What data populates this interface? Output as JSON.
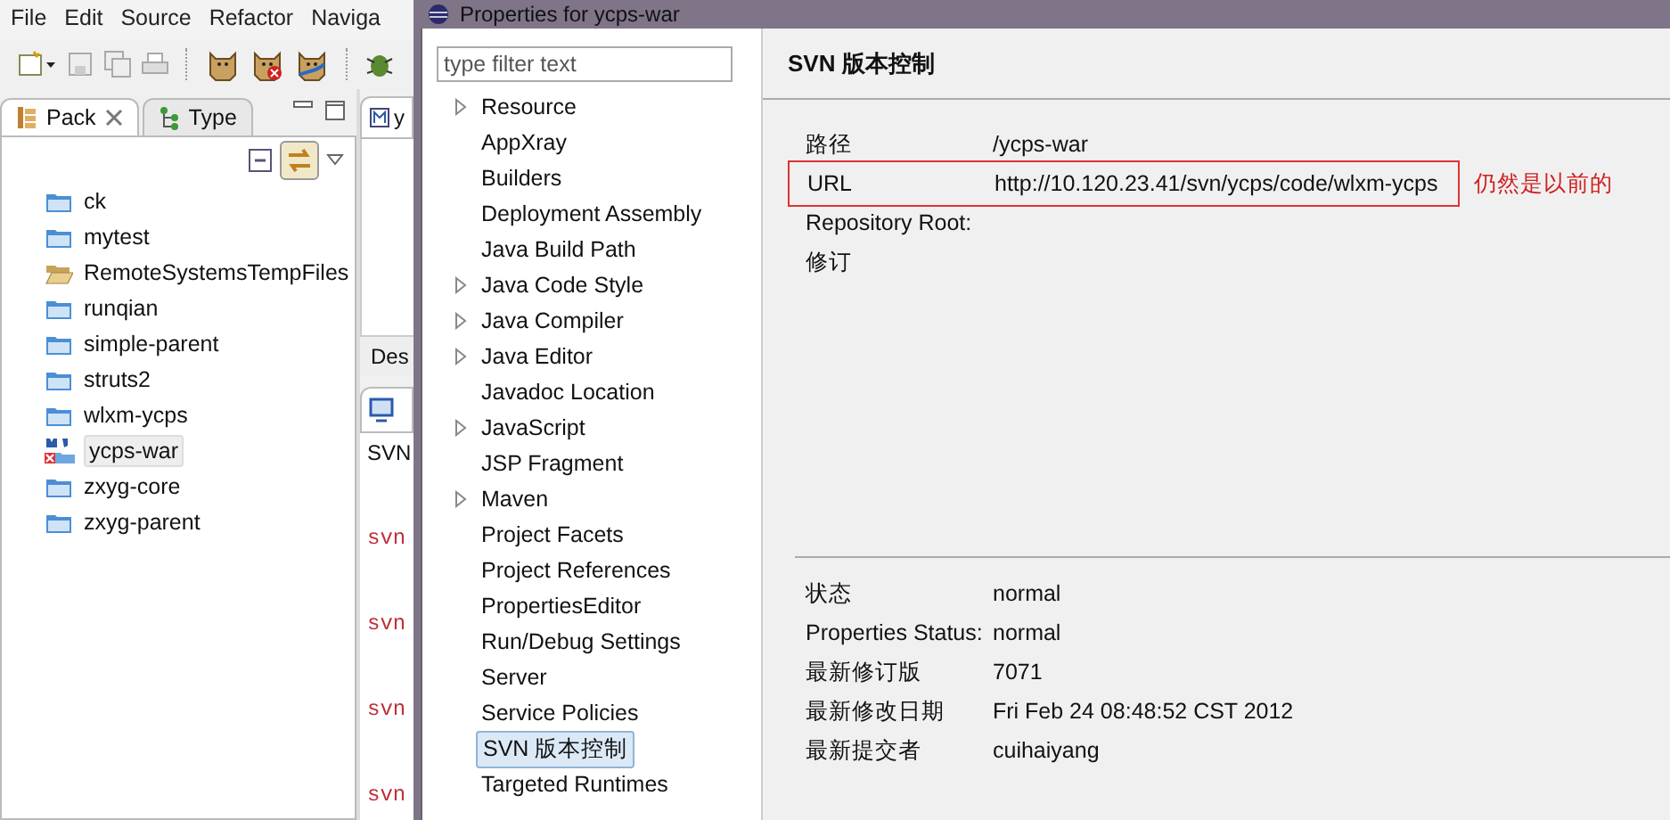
{
  "ide": {
    "menu": [
      "File",
      "Edit",
      "Source",
      "Refactor",
      "Naviga"
    ],
    "view_tabs": [
      {
        "label": "Pack",
        "selected": true
      },
      {
        "label": "Type",
        "selected": false
      }
    ],
    "link_with_editor": {
      "on": true
    },
    "projects": [
      {
        "name": "ck",
        "kind": "folder",
        "selected": false
      },
      {
        "name": "mytest",
        "kind": "folder",
        "selected": false
      },
      {
        "name": "RemoteSystemsTempFiles",
        "kind": "open-folder",
        "selected": false
      },
      {
        "name": "runqian",
        "kind": "folder",
        "selected": false
      },
      {
        "name": "simple-parent",
        "kind": "folder",
        "selected": false
      },
      {
        "name": "struts2",
        "kind": "folder",
        "selected": false
      },
      {
        "name": "wlxm-ycps",
        "kind": "folder",
        "selected": false
      },
      {
        "name": "ycps-war",
        "kind": "web-project",
        "selected": true
      },
      {
        "name": "zxyg-core",
        "kind": "folder",
        "selected": false
      },
      {
        "name": "zxyg-parent",
        "kind": "folder",
        "selected": false
      }
    ],
    "editor_tab": "y",
    "outline_tab": "Des",
    "console_header": "SVN",
    "console_lines": [
      "svn",
      "svn",
      "svn",
      "svn"
    ]
  },
  "dialog": {
    "title": "Properties for ycps-war",
    "filter": {
      "placeholder": "type filter text"
    },
    "pages": [
      {
        "label": "Resource",
        "expandable": true,
        "selected": false
      },
      {
        "label": "AppXray",
        "expandable": false,
        "selected": false
      },
      {
        "label": "Builders",
        "expandable": false,
        "selected": false
      },
      {
        "label": "Deployment Assembly",
        "expandable": false,
        "selected": false
      },
      {
        "label": "Java Build Path",
        "expandable": false,
        "selected": false
      },
      {
        "label": "Java Code Style",
        "expandable": true,
        "selected": false
      },
      {
        "label": "Java Compiler",
        "expandable": true,
        "selected": false
      },
      {
        "label": "Java Editor",
        "expandable": true,
        "selected": false
      },
      {
        "label": "Javadoc Location",
        "expandable": false,
        "selected": false
      },
      {
        "label": "JavaScript",
        "expandable": true,
        "selected": false
      },
      {
        "label": "JSP Fragment",
        "expandable": false,
        "selected": false
      },
      {
        "label": "Maven",
        "expandable": true,
        "selected": false
      },
      {
        "label": "Project Facets",
        "expandable": false,
        "selected": false
      },
      {
        "label": "Project References",
        "expandable": false,
        "selected": false
      },
      {
        "label": "PropertiesEditor",
        "expandable": false,
        "selected": false
      },
      {
        "label": "Run/Debug Settings",
        "expandable": false,
        "selected": false
      },
      {
        "label": "Server",
        "expandable": false,
        "selected": false
      },
      {
        "label": "Service Policies",
        "expandable": false,
        "selected": false
      },
      {
        "label": "SVN 版本控制",
        "expandable": false,
        "selected": true
      },
      {
        "label": "Targeted Runtimes",
        "expandable": false,
        "selected": false
      }
    ],
    "heading": "SVN 版本控制",
    "info": [
      {
        "label": "路径",
        "value": "/ycps-war",
        "highlighted": false
      },
      {
        "label": "URL",
        "value": "http://10.120.23.41/svn/ycps/code/wlxm-ycps",
        "highlighted": true
      },
      {
        "label": "Repository Root:",
        "highlighted": false
      },
      {
        "label": "修订",
        "highlighted": false
      }
    ],
    "annotation": "仍然是以前的",
    "status": [
      {
        "label": "状态",
        "value": "normal"
      },
      {
        "label": "Properties Status:",
        "value": "normal"
      },
      {
        "label": "最新修订版",
        "value": "7071"
      },
      {
        "label": "最新修改日期",
        "value": "Fri Feb 24 08:48:52 CST 2012"
      },
      {
        "label": "最新提交者",
        "value": "cuihaiyang"
      }
    ]
  }
}
